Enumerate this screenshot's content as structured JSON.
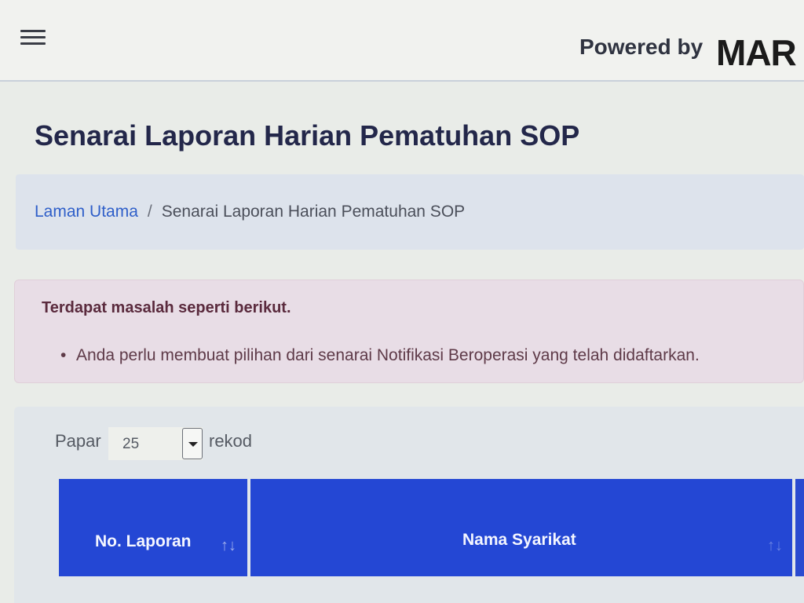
{
  "header": {
    "menu_icon": "hamburger-menu-icon",
    "powered_by": "Powered by",
    "brand": "MAR"
  },
  "page": {
    "title": "Senarai Laporan Harian Pematuhan SOP"
  },
  "breadcrumb": {
    "home": "Laman Utama",
    "separator": "/",
    "current": "Senarai Laporan Harian Pematuhan SOP"
  },
  "alert": {
    "title": "Terdapat masalah seperti berikut.",
    "items": [
      "Anda perlu membuat pilihan dari senarai Notifikasi Beroperasi yang telah didaftarkan."
    ]
  },
  "table": {
    "length": {
      "prefix": "Papar",
      "value": "25",
      "suffix": "rekod"
    },
    "columns": [
      {
        "label": "No. Laporan",
        "sort_icon": "sort-arrows-icon"
      },
      {
        "label": "Nama Syarikat",
        "sort_icon": "sort-arrows-icon"
      }
    ]
  },
  "colors": {
    "table_header": "#2447d4",
    "breadcrumb_link": "#2f5fc9",
    "alert_bg": "#e8dde6",
    "title": "#23274a"
  }
}
